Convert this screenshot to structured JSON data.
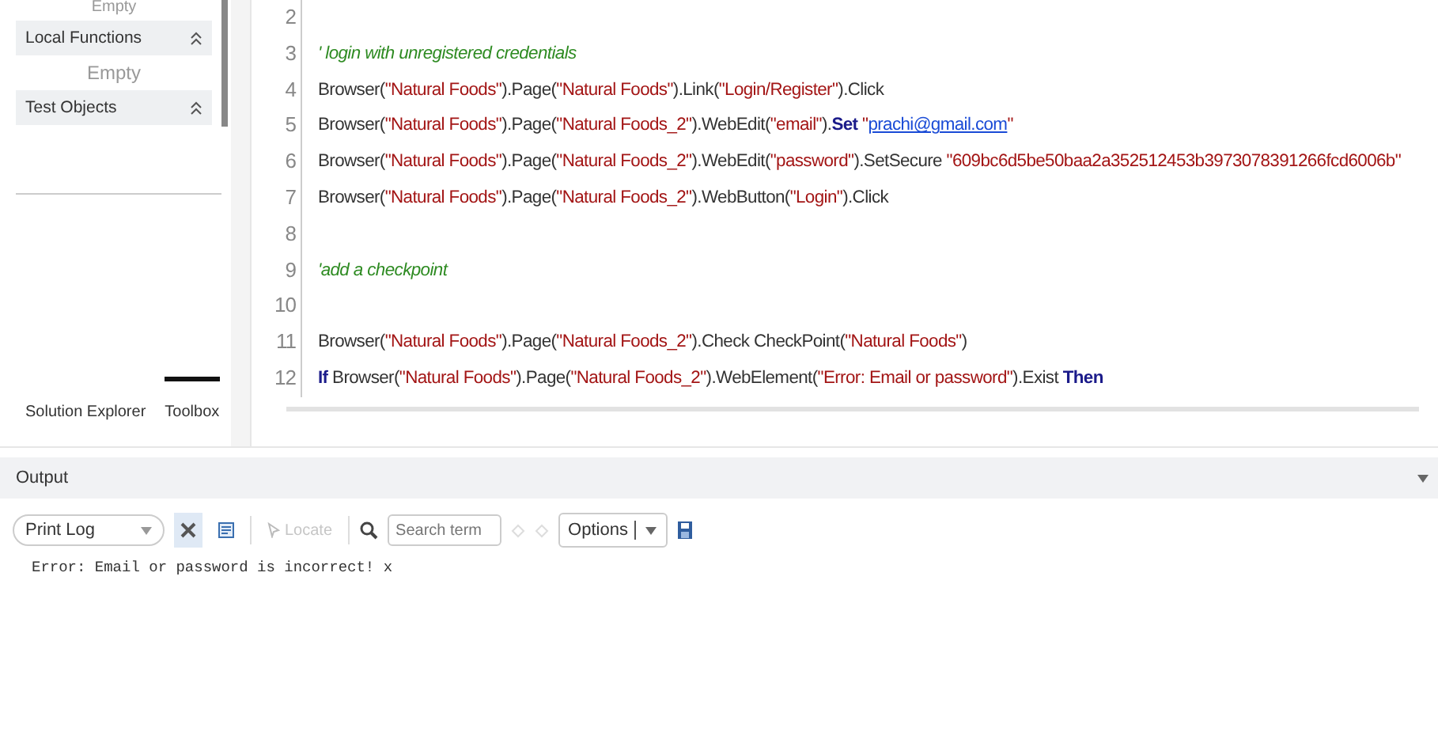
{
  "sidebar": {
    "sections": [
      {
        "kind": "note",
        "text": "Empty"
      },
      {
        "kind": "header",
        "label": "Local Functions",
        "expanded": true
      },
      {
        "kind": "note",
        "text": "Empty"
      },
      {
        "kind": "header",
        "label": "Test Objects",
        "expanded": true
      }
    ],
    "tabs": [
      {
        "label": "Solution Explorer",
        "selected": false
      },
      {
        "label": "Toolbox",
        "selected": true
      }
    ]
  },
  "editor": {
    "lines": [
      {
        "number": "2"
      },
      {
        "number": "3",
        "tokens": [
          {
            "kind": "comment",
            "text": "' login with unregistered credentials"
          }
        ]
      },
      {
        "number": "4",
        "tokens": [
          {
            "kind": "plain",
            "text": "Browser("
          },
          {
            "kind": "string",
            "text": "\"Natural Foods\""
          },
          {
            "kind": "plain",
            "text": ").Page("
          },
          {
            "kind": "string",
            "text": "\"Natural Foods\""
          },
          {
            "kind": "plain",
            "text": ").Link("
          },
          {
            "kind": "string",
            "text": "\"Login/Register\""
          },
          {
            "kind": "plain",
            "text": ").Click"
          }
        ]
      },
      {
        "number": "5",
        "tokens": [
          {
            "kind": "plain",
            "text": "Browser("
          },
          {
            "kind": "string",
            "text": "\"Natural Foods\""
          },
          {
            "kind": "plain",
            "text": ").Page("
          },
          {
            "kind": "string",
            "text": "\"Natural Foods_2\""
          },
          {
            "kind": "plain",
            "text": ").WebEdit("
          },
          {
            "kind": "string",
            "text": "\"email\""
          },
          {
            "kind": "plain",
            "text": ")."
          },
          {
            "kind": "keyword",
            "text": "Set"
          },
          {
            "kind": "string",
            "text": " \""
          },
          {
            "kind": "link",
            "text": "prachi@gmail.com"
          },
          {
            "kind": "string",
            "text": "\""
          }
        ]
      },
      {
        "number": "6",
        "tokens": [
          {
            "kind": "plain",
            "text": "Browser("
          },
          {
            "kind": "string",
            "text": "\"Natural Foods\""
          },
          {
            "kind": "plain",
            "text": ").Page("
          },
          {
            "kind": "string",
            "text": "\"Natural Foods_2\""
          },
          {
            "kind": "plain",
            "text": ").WebEdit("
          },
          {
            "kind": "string",
            "text": "\"password\""
          },
          {
            "kind": "plain",
            "text": ").SetSecure "
          },
          {
            "kind": "string",
            "text": "\"609bc6d5be50baa2a352512453b3973078391266fcd6006b\""
          }
        ]
      },
      {
        "number": "7",
        "tokens": [
          {
            "kind": "plain",
            "text": "Browser("
          },
          {
            "kind": "string",
            "text": "\"Natural Foods\""
          },
          {
            "kind": "plain",
            "text": ").Page("
          },
          {
            "kind": "string",
            "text": "\"Natural Foods_2\""
          },
          {
            "kind": "plain",
            "text": ").WebButton("
          },
          {
            "kind": "string",
            "text": "\"Login\""
          },
          {
            "kind": "plain",
            "text": ").Click"
          }
        ]
      },
      {
        "number": "8"
      },
      {
        "number": "9",
        "tokens": [
          {
            "kind": "comment",
            "text": "'add a checkpoint"
          }
        ]
      },
      {
        "number": "10"
      },
      {
        "number": "11",
        "tokens": [
          {
            "kind": "plain",
            "text": "Browser("
          },
          {
            "kind": "string",
            "text": "\"Natural Foods\""
          },
          {
            "kind": "plain",
            "text": ").Page("
          },
          {
            "kind": "string",
            "text": "\"Natural Foods_2\""
          },
          {
            "kind": "plain",
            "text": ").Check CheckPoint("
          },
          {
            "kind": "string",
            "text": "\"Natural Foods\""
          },
          {
            "kind": "plain",
            "text": ")"
          }
        ]
      },
      {
        "number": "12",
        "tokens": [
          {
            "kind": "keyword",
            "text": "If"
          },
          {
            "kind": "plain",
            "text": " Browser("
          },
          {
            "kind": "string",
            "text": "\"Natural Foods\""
          },
          {
            "kind": "plain",
            "text": ").Page("
          },
          {
            "kind": "string",
            "text": "\"Natural Foods_2\""
          },
          {
            "kind": "plain",
            "text": ").WebElement("
          },
          {
            "kind": "string",
            "text": "\"Error: Email or password\""
          },
          {
            "kind": "plain",
            "text": ").Exist "
          },
          {
            "kind": "keyword",
            "text": "Then"
          }
        ]
      }
    ]
  },
  "output": {
    "title": "Output",
    "toolbar": {
      "log_select": "Print Log",
      "locate": {
        "label": "Locate",
        "disabled": true
      },
      "search": {
        "placeholder": "Search term"
      },
      "options": "Options"
    },
    "log": [
      "Error: Email or password is incorrect! x"
    ]
  }
}
